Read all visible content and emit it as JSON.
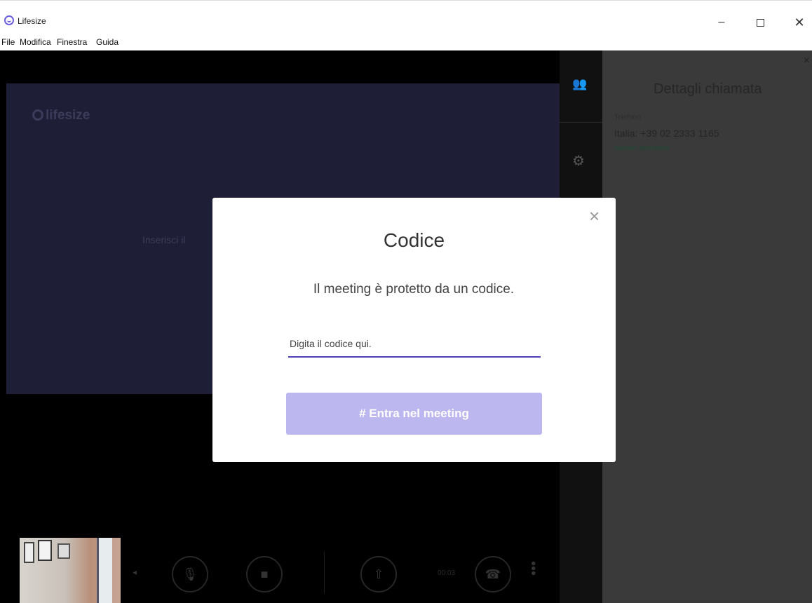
{
  "window": {
    "title": "Lifesize",
    "minimize": "–",
    "close": "✕"
  },
  "menu": {
    "items": [
      "File",
      "Modifica",
      "Finestra",
      "Guida"
    ]
  },
  "video": {
    "brand": "lifesize",
    "prompt_partial": "Inserisci il"
  },
  "details": {
    "title": "Dettagli chiamata",
    "phone_label": "Telefono",
    "phone": "Italia: +39 02 2333 1165",
    "alt_numbers": "Numeri alternativi",
    "close": "×"
  },
  "controls": {
    "timer": "00:03"
  },
  "modal": {
    "title": "Codice",
    "message": "Il meeting è protetto da un codice.",
    "input_placeholder": "Digita il codice qui.",
    "join_label": "# Entra nel meeting",
    "close": "×"
  }
}
